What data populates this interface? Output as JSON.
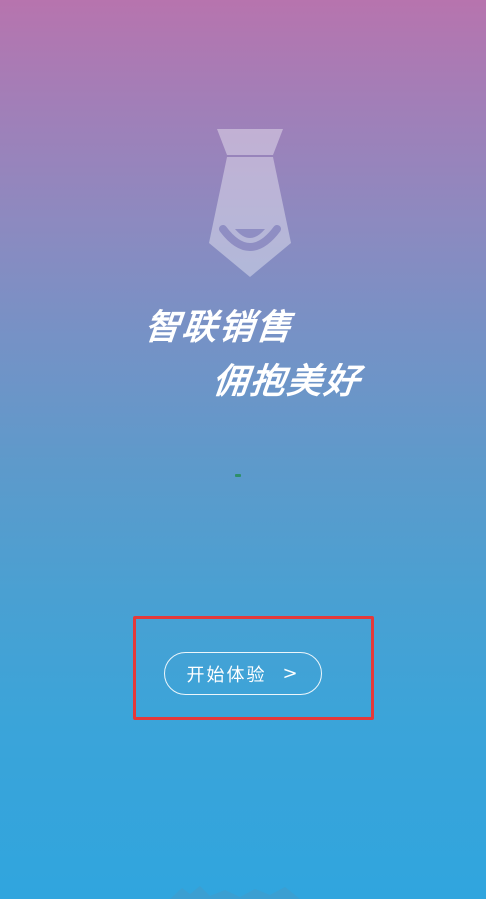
{
  "splash": {
    "slogan_line1": "智联销售",
    "slogan_line2": "佣抱美好",
    "start_button_label": "开始体验",
    "start_button_arrow": ">"
  },
  "icons": {
    "logo": "tie-logo-icon",
    "arrow": "chevron-right-icon"
  },
  "colors": {
    "gradient_top": "#b774ae",
    "gradient_bottom": "#30a5de",
    "highlight_border": "#e5393a",
    "text": "#ffffff"
  }
}
